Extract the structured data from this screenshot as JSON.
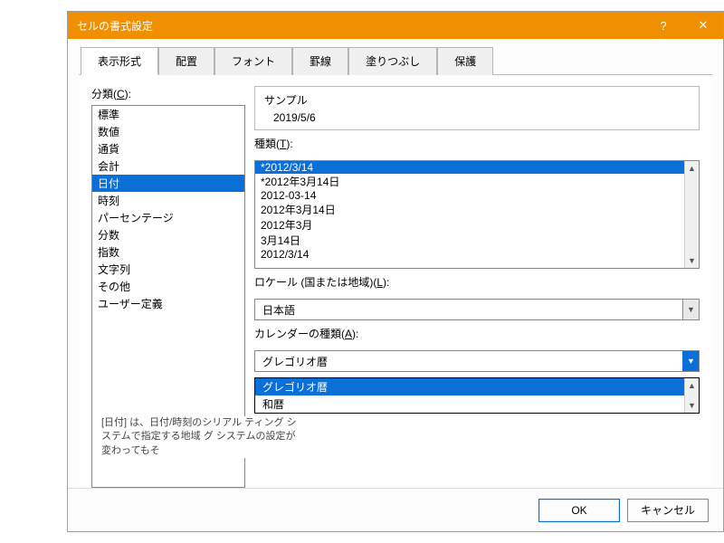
{
  "window": {
    "title": "セルの書式設定",
    "help": "?",
    "close": "✕"
  },
  "tabs": [
    "表示形式",
    "配置",
    "フォント",
    "罫線",
    "塗りつぶし",
    "保護"
  ],
  "active_tab": 0,
  "category": {
    "label_prefix": "分類(",
    "accel": "C",
    "label_suffix": "):",
    "selected_index": 4,
    "items": [
      "標準",
      "数値",
      "通貨",
      "会計",
      "日付",
      "時刻",
      "パーセンテージ",
      "分数",
      "指数",
      "文字列",
      "その他",
      "ユーザー定義"
    ]
  },
  "sample": {
    "title": "サンプル",
    "value": "2019/5/6"
  },
  "type": {
    "label_prefix": "種類(",
    "accel": "T",
    "label_suffix": "):",
    "selected_index": 0,
    "items": [
      "*2012/3/14",
      "*2012年3月14日",
      "2012-03-14",
      "2012年3月14日",
      "2012年3月",
      "3月14日",
      "2012/3/14"
    ]
  },
  "locale": {
    "label_prefix": "ロケール (国または地域)(",
    "accel": "L",
    "label_suffix": "):",
    "value": "日本語"
  },
  "calendar": {
    "label_prefix": "カレンダーの種類(",
    "accel": "A",
    "label_suffix": "):",
    "value": "グレゴリオ暦",
    "options": [
      "グレゴリオ暦",
      "和暦"
    ],
    "open": true,
    "selected_index": 0
  },
  "description": "[日付] は、日付/時刻のシリアル\nティング システムで指定する地域\nグ システムの設定が変わってもそ",
  "buttons": {
    "ok": "OK",
    "cancel": "キャンセル"
  }
}
